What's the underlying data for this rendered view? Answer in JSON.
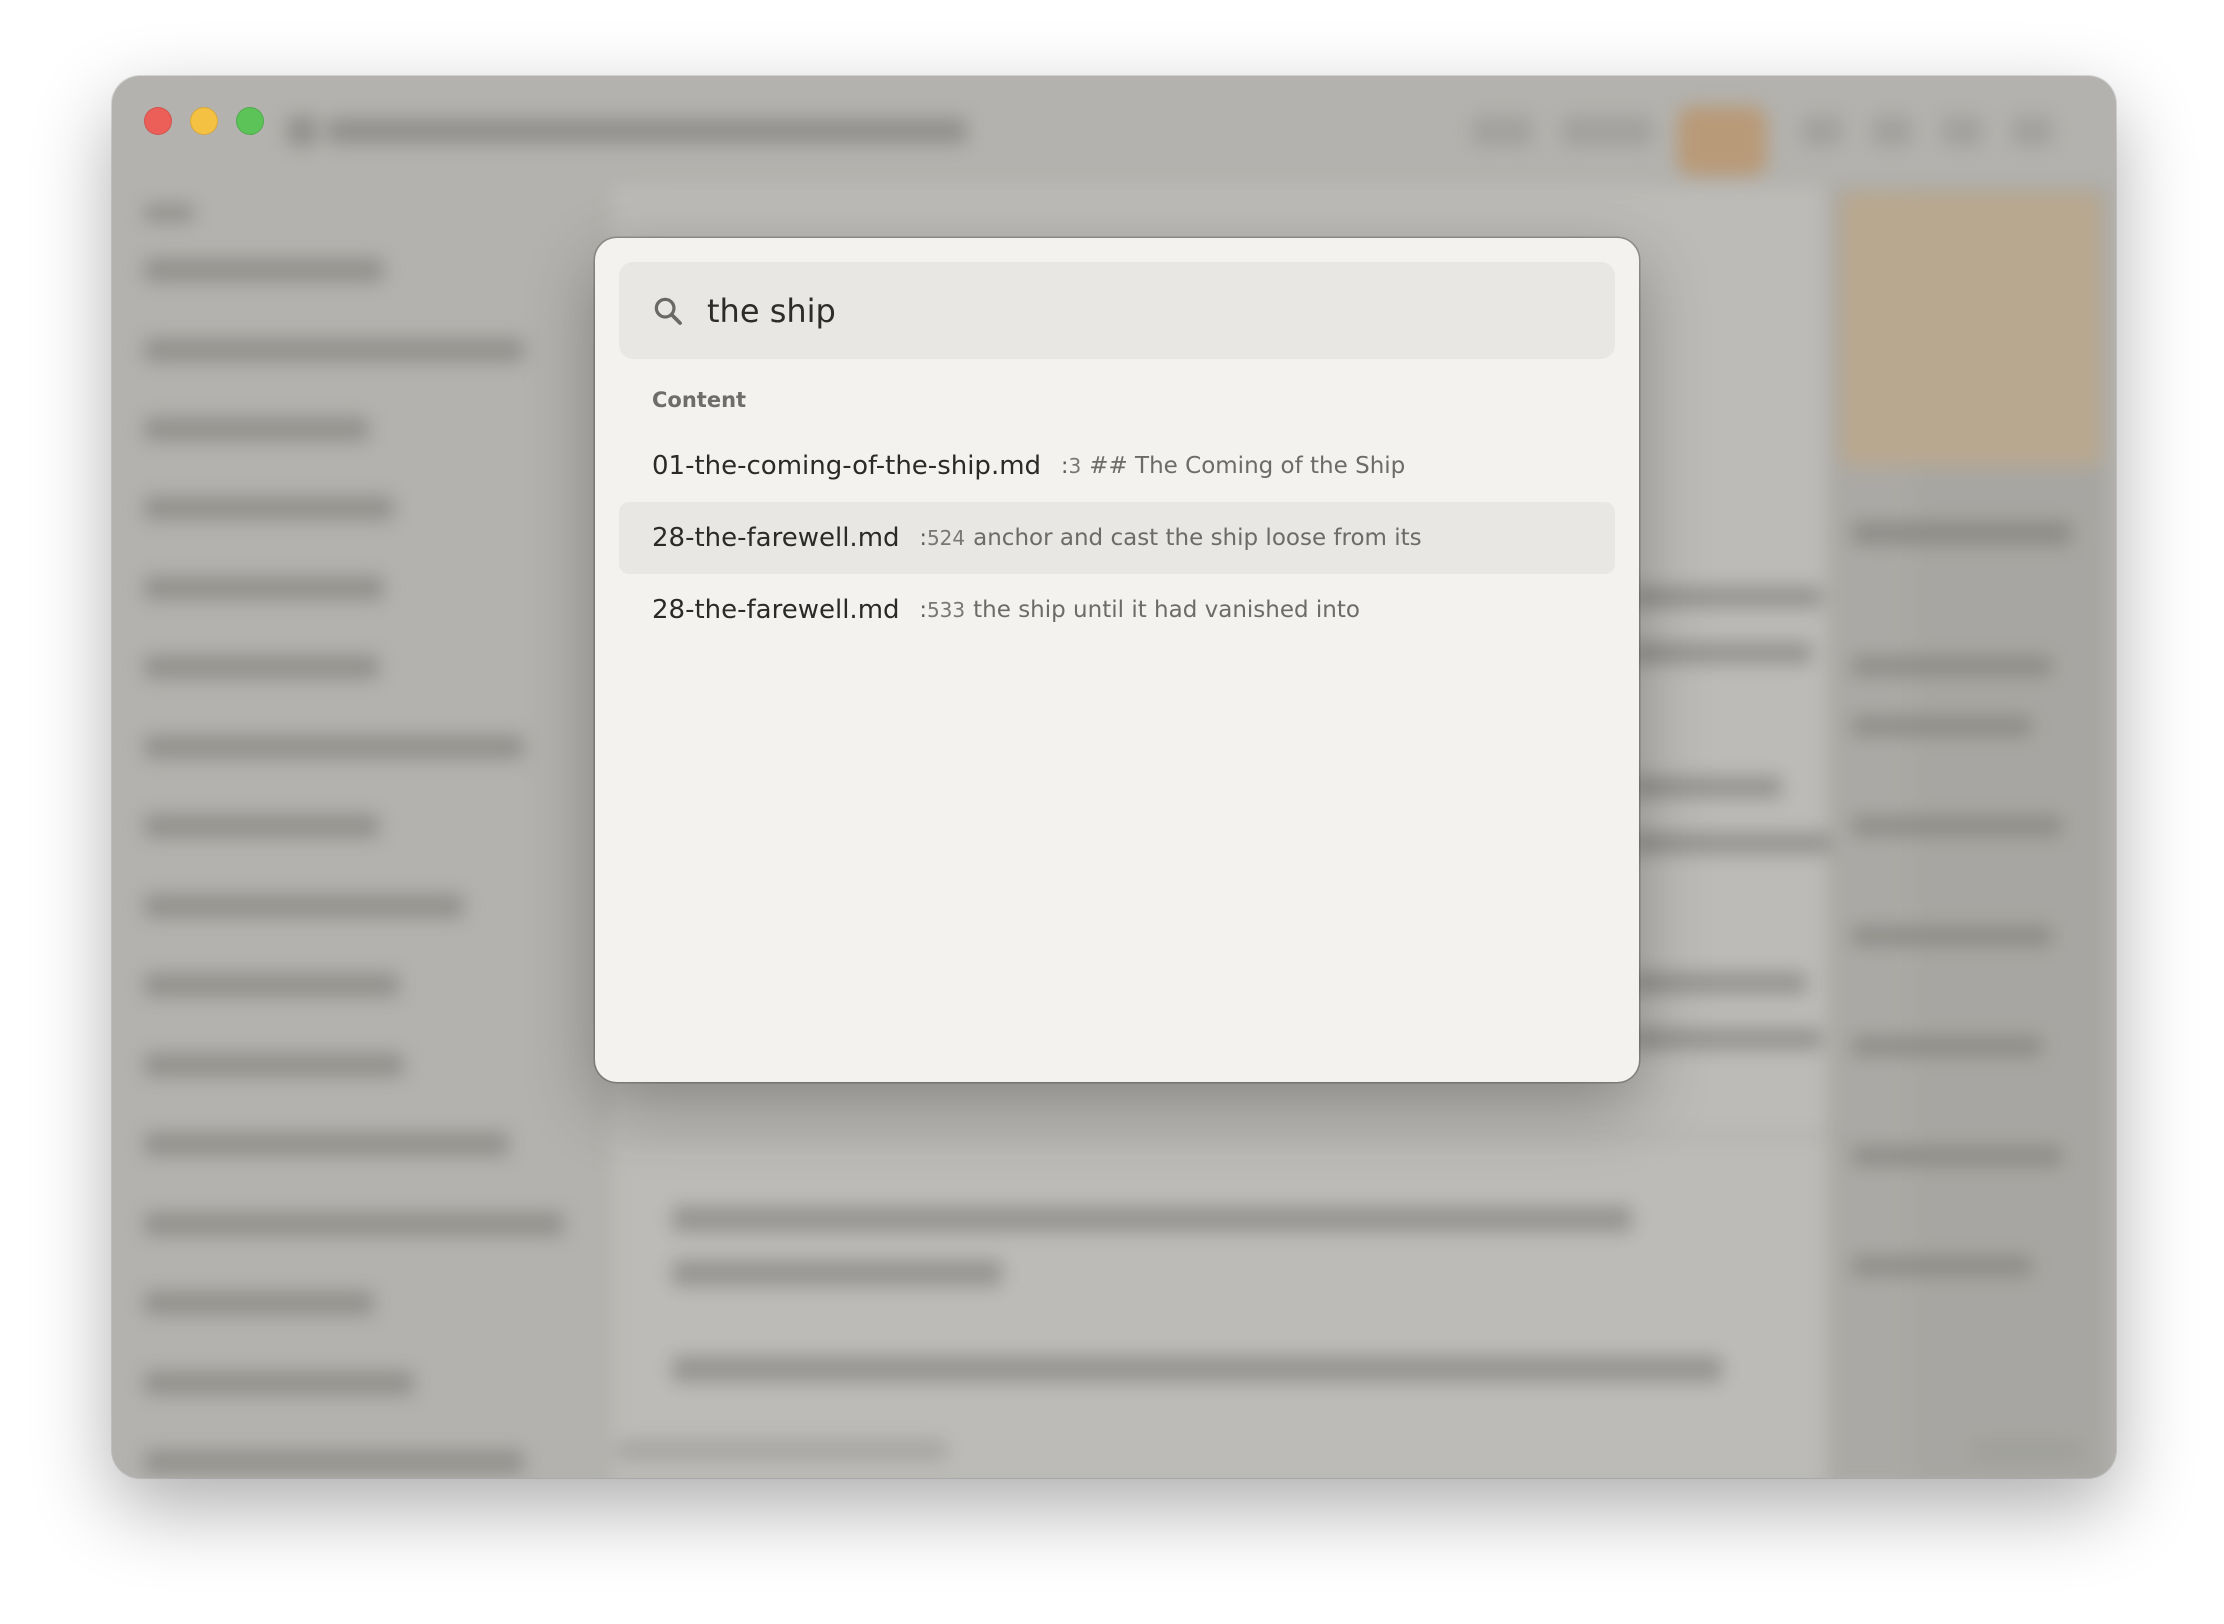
{
  "window": {
    "controls": [
      "close",
      "minimize",
      "zoom"
    ]
  },
  "search": {
    "value": "the ship",
    "icon": "search-icon"
  },
  "results": {
    "section_label": "Content",
    "separator": ":",
    "items": [
      {
        "file": "01-the-coming-of-the-ship.md",
        "line": "3",
        "snippet": "## The Coming of the Ship",
        "selected": false
      },
      {
        "file": "28-the-farewell.md",
        "line": "524",
        "snippet": "anchor and cast the ship loose from its",
        "selected": true
      },
      {
        "file": "28-the-farewell.md",
        "line": "533",
        "snippet": "the ship until it had vanished into",
        "selected": false
      }
    ]
  }
}
